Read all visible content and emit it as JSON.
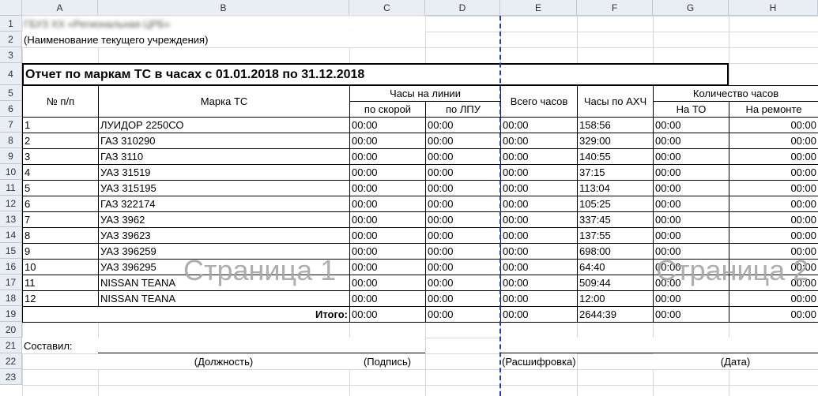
{
  "columns": [
    "A",
    "B",
    "C",
    "D",
    "E",
    "F",
    "G",
    "H"
  ],
  "rows": [
    "1",
    "2",
    "3",
    "4",
    "5",
    "6",
    "7",
    "8",
    "9",
    "10",
    "11",
    "12",
    "13",
    "14",
    "15",
    "16",
    "17",
    "18",
    "19",
    "20",
    "21",
    "22",
    "23"
  ],
  "sheet": {
    "row1": "ГБУЗ ХХ «Региональная ЦРБ»",
    "institution": "(Наименование текущего учреждения)",
    "title": "Отчет по маркам ТС в часах с 01.01.2018 по 31.12.2018",
    "headers": {
      "num": "№ п/п",
      "brand": "Марка ТС",
      "line_hours": "Часы на линии",
      "ambulance": "по скорой",
      "lpu": "по ЛПУ",
      "total": "Всего часов",
      "ahch": "Часы по АХЧ",
      "count": "Количество часов",
      "to": "На ТО",
      "repair": "На ремонте"
    },
    "data": [
      [
        "1",
        "ЛУИДОР 2250СО",
        "00:00",
        "00:00",
        "00:00",
        "158:56",
        "00:00",
        "00:00"
      ],
      [
        "2",
        "ГАЗ 310290",
        "00:00",
        "00:00",
        "00:00",
        "329:00",
        "00:00",
        "00:00"
      ],
      [
        "3",
        "ГАЗ 3110",
        "00:00",
        "00:00",
        "00:00",
        "140:55",
        "00:00",
        "00:00"
      ],
      [
        "4",
        "УАЗ 31519",
        "00:00",
        "00:00",
        "00:00",
        "37:15",
        "00:00",
        "00:00"
      ],
      [
        "5",
        "УАЗ 315195",
        "00:00",
        "00:00",
        "00:00",
        "113:04",
        "00:00",
        "00:00"
      ],
      [
        "6",
        "ГАЗ 322174",
        "00:00",
        "00:00",
        "00:00",
        "105:25",
        "00:00",
        "00:00"
      ],
      [
        "7",
        "УАЗ 3962",
        "00:00",
        "00:00",
        "00:00",
        "337:45",
        "00:00",
        "00:00"
      ],
      [
        "8",
        "УАЗ 39623",
        "00:00",
        "00:00",
        "00:00",
        "137:55",
        "00:00",
        "00:00"
      ],
      [
        "9",
        "УАЗ 396259",
        "00:00",
        "00:00",
        "00:00",
        "698:00",
        "00:00",
        "00:00"
      ],
      [
        "10",
        "УАЗ 396295",
        "00:00",
        "00:00",
        "00:00",
        "64:40",
        "00:00",
        "00:00"
      ],
      [
        "11",
        "NISSAN TEANA",
        "00:00",
        "00:00",
        "00:00",
        "509:44",
        "00:00",
        "00:00"
      ],
      [
        "12",
        "NISSAN TEANA",
        "00:00",
        "00:00",
        "00:00",
        "12:00",
        "00:00",
        "00:00"
      ]
    ],
    "totals": {
      "label": "Итого:",
      "c": "00:00",
      "d": "00:00",
      "e": "00:00",
      "f": "2644:39",
      "g": "00:00",
      "h": "00:00"
    },
    "compiled": "Составил:",
    "position": "(Должность)",
    "signature": "(Подпись)",
    "decoding": "(Расшифровка)",
    "date": "(Дата)"
  },
  "watermarks": {
    "page1": "Страница 1",
    "page2": "Страница 2"
  },
  "colors": {
    "page_break": "#2337b0",
    "header_bg": "#e9edf4",
    "watermark": "#a6a6a6"
  }
}
